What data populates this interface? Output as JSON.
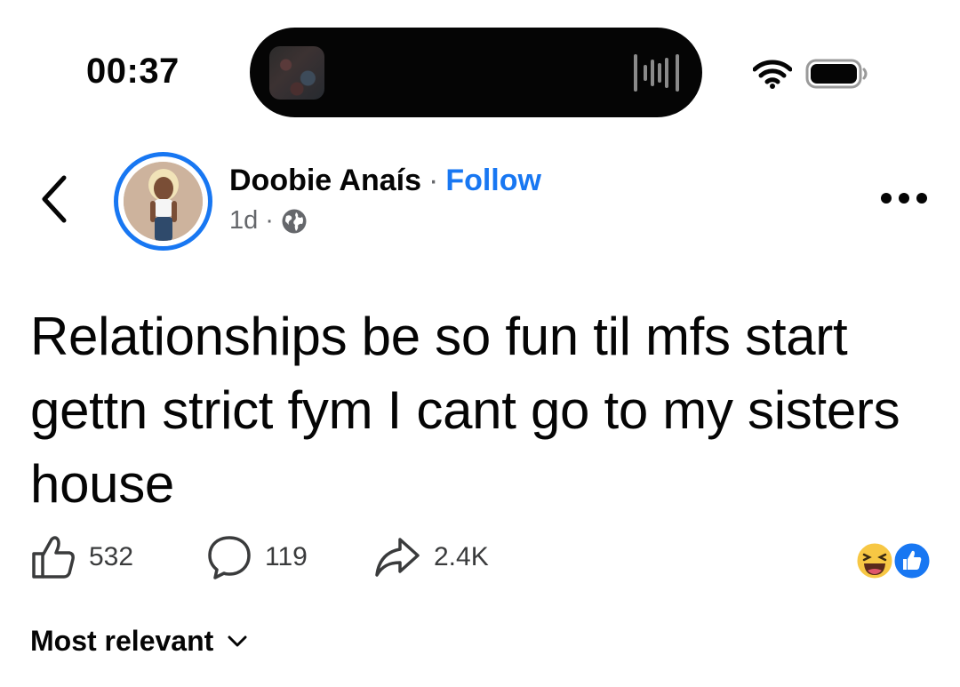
{
  "status_bar": {
    "time": "00:37",
    "icons": [
      "dynamic-island",
      "audio-waveform-icon",
      "wifi-icon",
      "battery-icon"
    ]
  },
  "post": {
    "author_name": "Doobie Anaís",
    "separator": "·",
    "follow_label": "Follow",
    "timestamp": "1d",
    "privacy_icon": "globe-icon",
    "text": "Relationships be so fun til mfs start gettn strict fym I cant go to my sisters house",
    "accent_color": "#1877f2"
  },
  "actions": {
    "likes": "532",
    "comments": "119",
    "shares": "2.4K"
  },
  "reactions": [
    "haha-emoji",
    "like-reaction"
  ],
  "comments_sort": {
    "label": "Most relevant"
  }
}
